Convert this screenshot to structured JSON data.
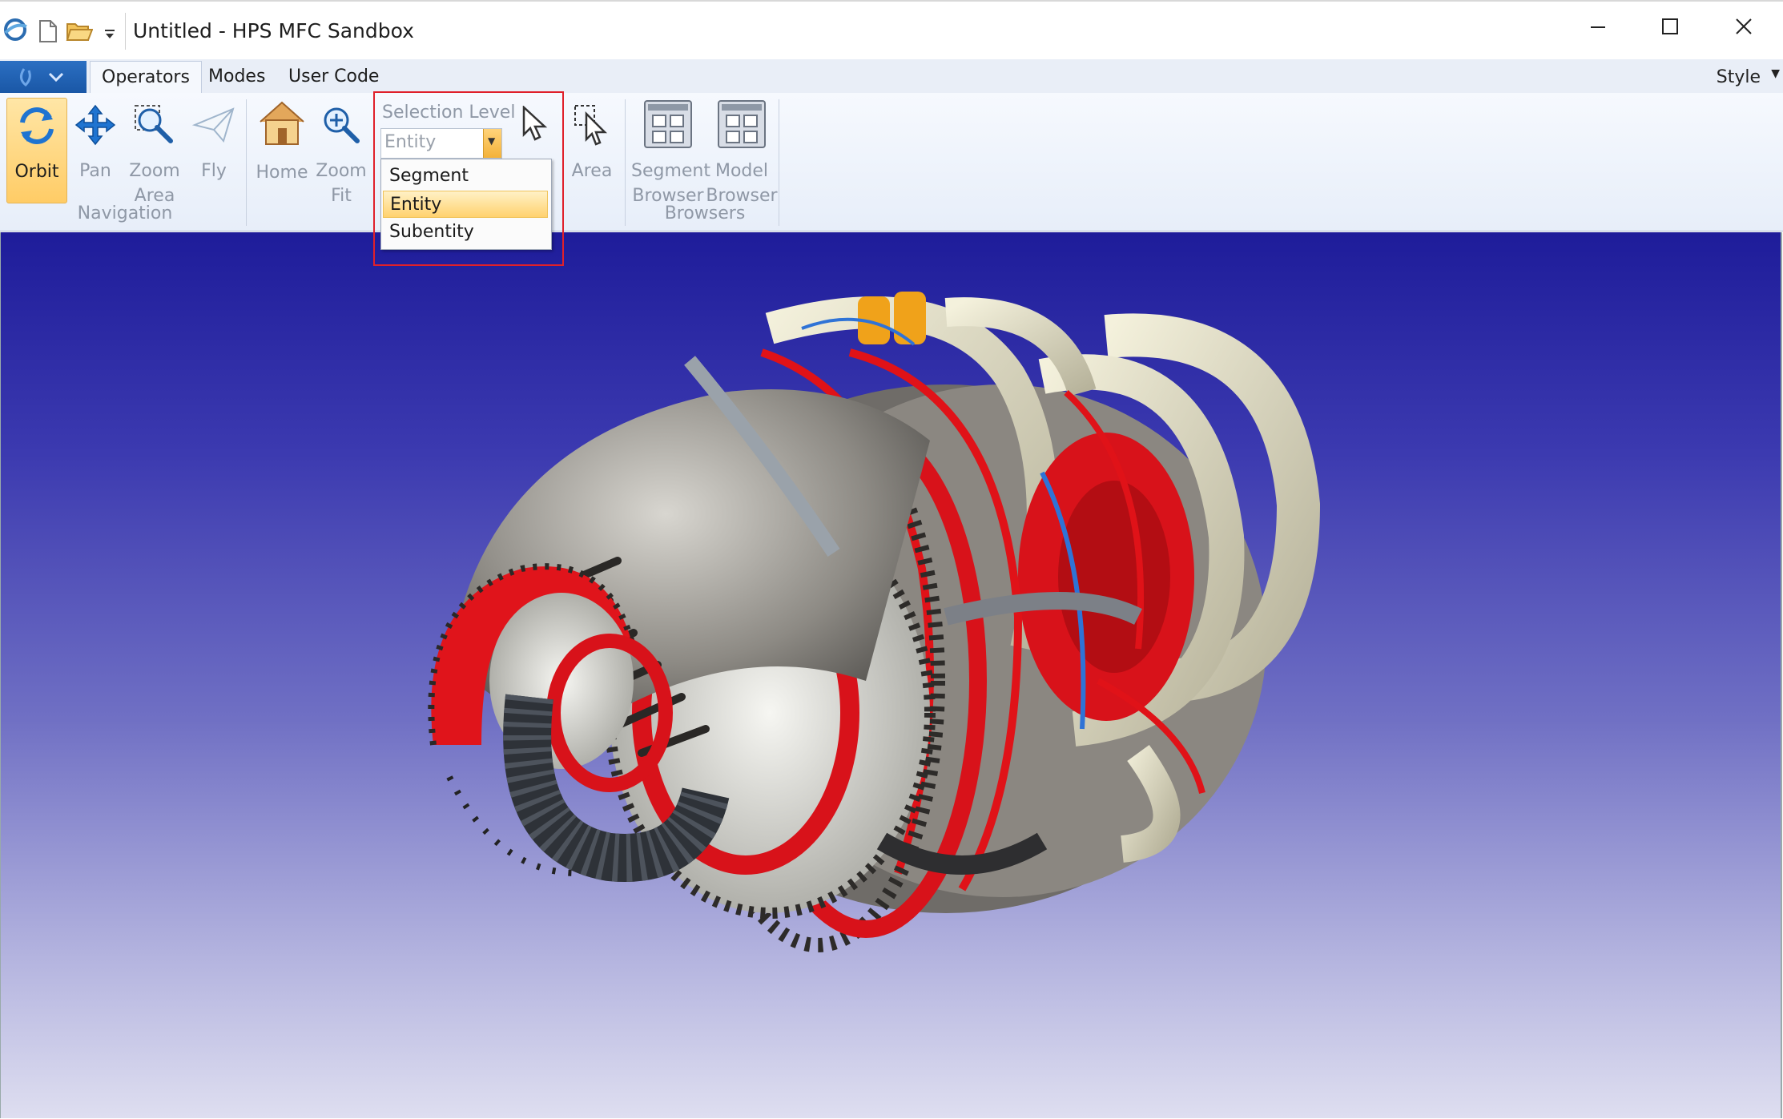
{
  "window": {
    "title": "Untitled - HPS MFC Sandbox"
  },
  "tabs": [
    {
      "label": "Operators",
      "active": true
    },
    {
      "label": "Modes",
      "active": false
    },
    {
      "label": "User Code",
      "active": false
    }
  ],
  "style_menu": {
    "label": "Style"
  },
  "ribbon": {
    "navigation": {
      "group_label": "Navigation",
      "orbit": "Orbit",
      "pan": "Pan",
      "zoom_area_1": "Zoom",
      "zoom_area_2": "Area",
      "fly": "Fly"
    },
    "views": {
      "home": "Home",
      "zoom_fit_1": "Zoom",
      "zoom_fit_2": "Fit"
    },
    "selection": {
      "label": "Selection Level",
      "value": "Entity",
      "options": [
        "Segment",
        "Entity",
        "Subentity"
      ],
      "area": "Area"
    },
    "browsers": {
      "group_label": "Browsers",
      "segment_1": "Segment",
      "segment_2": "Browser",
      "model_1": "Model",
      "model_2": "Browser"
    }
  },
  "colors": {
    "viewport_top": "#1e1c9a",
    "viewport_bottom": "#dedef0",
    "highlight": "#e0202a",
    "active_button": "#ffcc66"
  }
}
